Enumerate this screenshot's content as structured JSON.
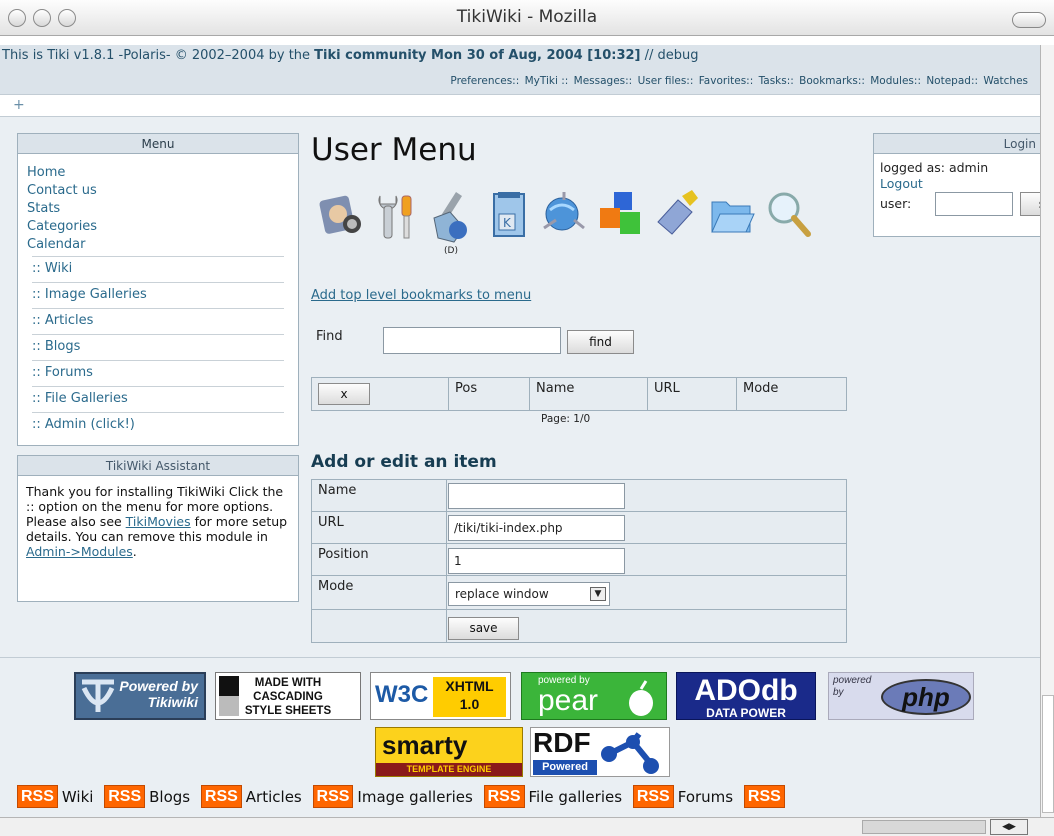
{
  "window": {
    "title": "TikiWiki - Mozilla"
  },
  "header": {
    "version": "This is Tiki v1.8.1 -Polaris- © 2002–2004 by the ",
    "community": "Tiki community",
    "date": " Mon 30 of Aug, 2004 [10:32]",
    "debug": "  // debug"
  },
  "topnav": [
    "Preferences::",
    "MyTiki ::",
    "Messages::",
    "User files::",
    "Favorites::",
    "Tasks::",
    "Bookmarks::",
    "Modules::",
    "Notepad::",
    "Watches"
  ],
  "plus": "+",
  "menu": {
    "title": "Menu",
    "links": [
      "Home",
      "Contact us",
      "Stats",
      "Categories",
      "Calendar"
    ],
    "sections": [
      ":: Wiki",
      ":: Image Galleries",
      ":: Articles",
      ":: Blogs",
      ":: Forums",
      ":: File Galleries",
      ":: Admin (click!)"
    ]
  },
  "assistant": {
    "title": "TikiWiki Assistant",
    "text1": "Thank you for installing TikiWiki Click the :: option on the menu for more options. Please also see ",
    "link1": "TikiMovies",
    "text2": " for more setup details. You can remove this module in ",
    "link2": "Admin->Modules",
    "text3": "."
  },
  "main": {
    "title": "User Menu",
    "icons": [
      "user-preferences-icon",
      "tools-icon",
      "user-files-icon",
      "notepad-icon",
      "watches-icon",
      "modules-icon",
      "tasks-icon",
      "folder-icon",
      "search-icon"
    ],
    "icon_caption": "(D)",
    "add_bookmarks": "Add top level bookmarks to menu",
    "find_label": "Find",
    "find_value": "",
    "find_button": "find",
    "cols": [
      "x",
      "Pos",
      "Name",
      "URL",
      "Mode"
    ],
    "page_info": "Page: 1/0"
  },
  "form": {
    "title": "Add or edit an item",
    "name_label": "Name",
    "name_value": "",
    "url_label": "URL",
    "url_value": "/tiki/tiki-index.php",
    "pos_label": "Position",
    "pos_value": "1",
    "mode_label": "Mode",
    "mode_value": "replace window",
    "save": "save"
  },
  "login": {
    "title": "Login",
    "logged": "logged as: admin",
    "logout": "Logout",
    "user_label": "user:",
    "user_value": "",
    "submit": "s"
  },
  "badges": {
    "tiki": "Powered by Tikiwiki",
    "css1": "MADE WITH",
    "css2": "CASCADING",
    "css3": "STYLE SHEETS",
    "w3c": "W3C",
    "xhtml": "XHTML",
    "xhtmlv": "1.0",
    "pear_small": "powered by",
    "pear": "pear",
    "adodb": "ADOdb",
    "adodb_sub": "DATA POWER",
    "php_small": "powered by",
    "php": "php",
    "smarty": "smarty",
    "smarty_sub": "TEMPLATE ENGINE",
    "rdf": "RDF",
    "rdf_sub": "Powered"
  },
  "rss": {
    "badge": "RSS",
    "labels": [
      "Wiki",
      "Blogs",
      "Articles",
      "Image galleries",
      "File galleries",
      "Forums"
    ]
  },
  "colors": {
    "accent": "#2a6a8c",
    "header_bg": "#dbe3ea",
    "rss": "#ff6600"
  }
}
